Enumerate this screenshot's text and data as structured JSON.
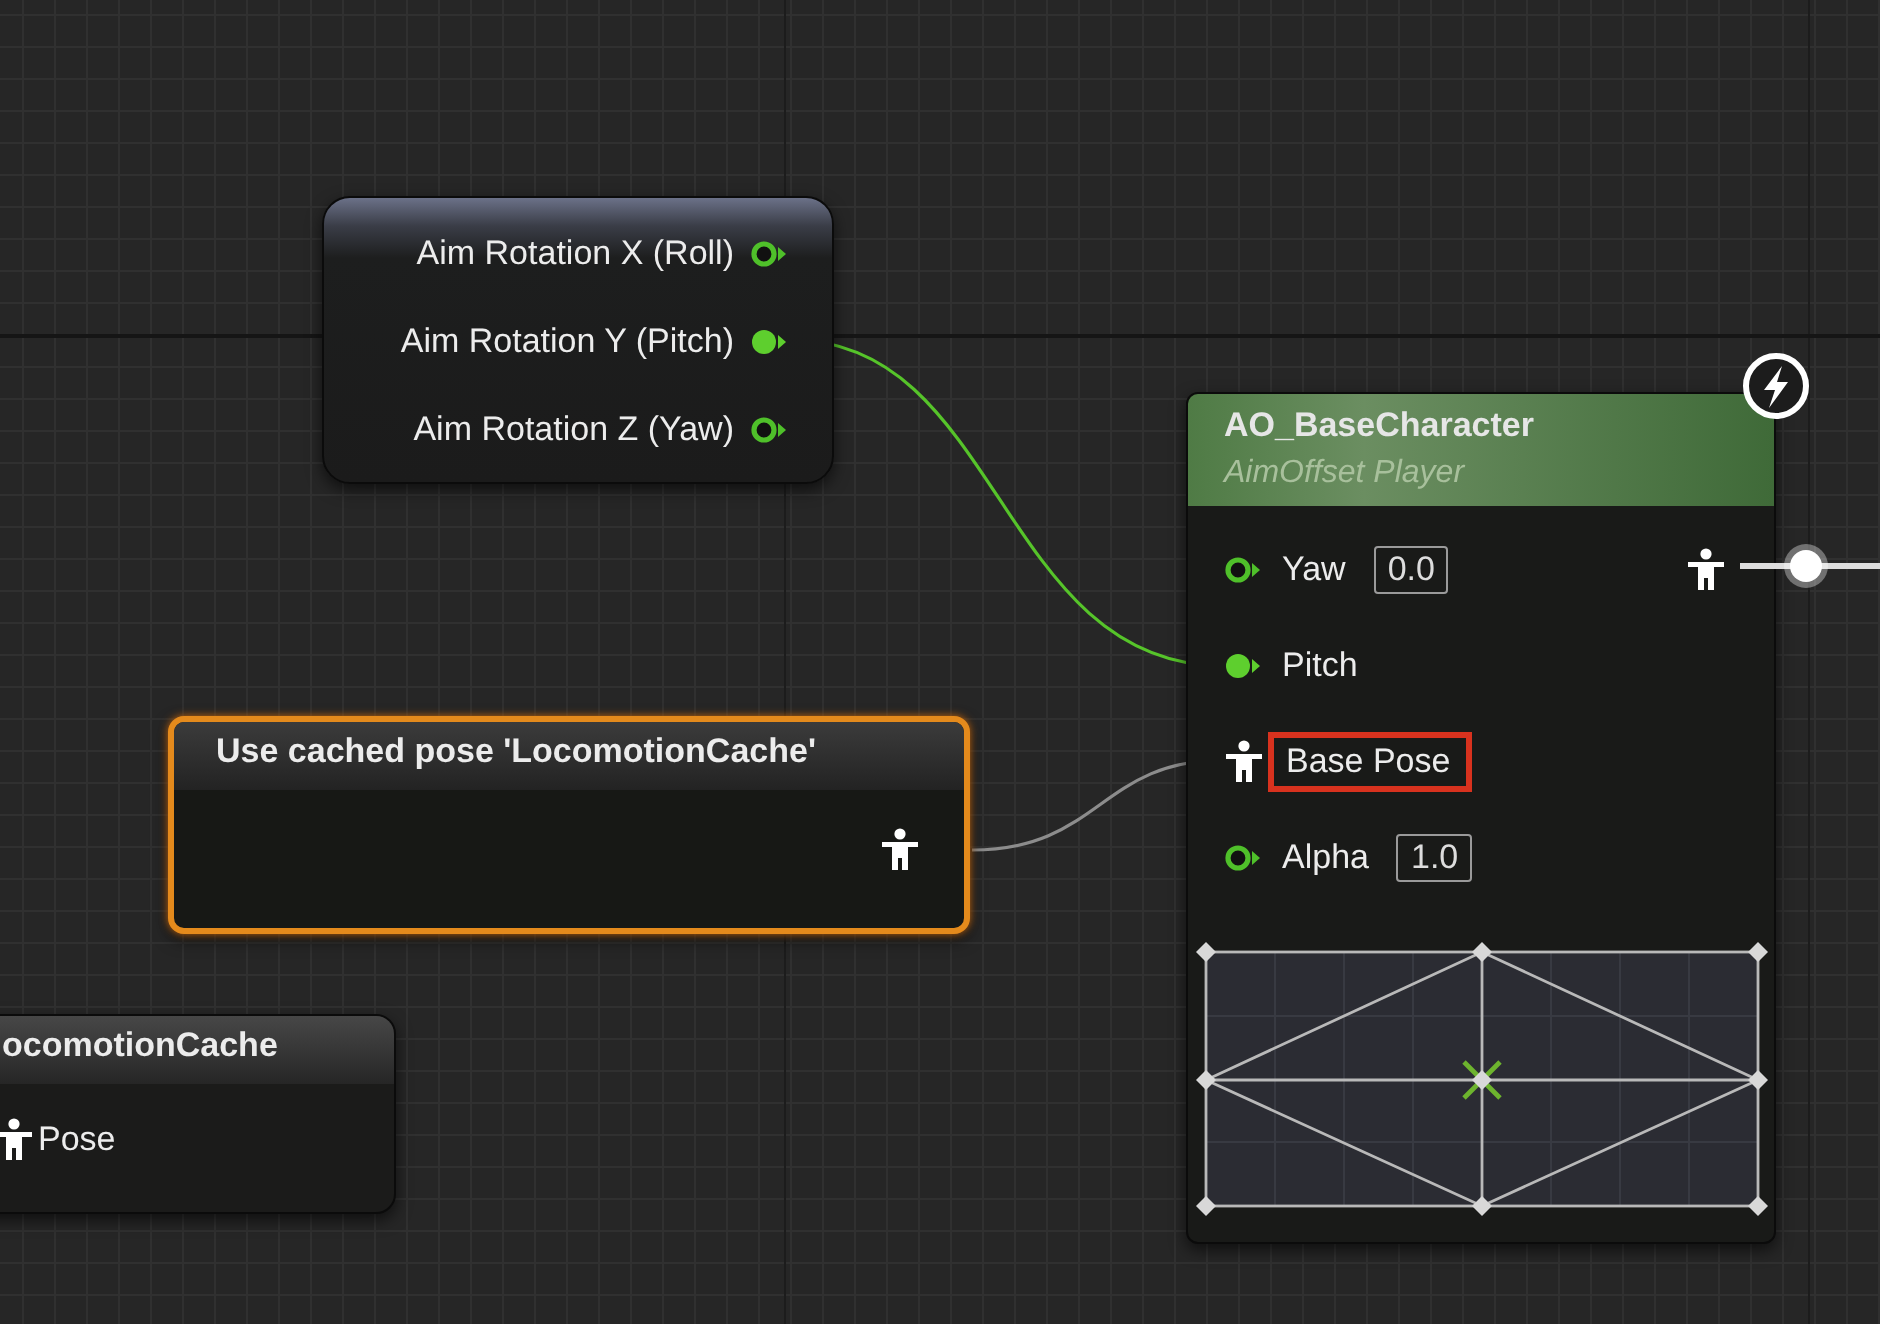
{
  "graph": {
    "nodes": [
      {
        "kind": "getter",
        "pins": [
          {
            "label": "Aim Rotation X (Roll)",
            "connected": false
          },
          {
            "label": "Aim Rotation Y (Pitch)",
            "connected": true
          },
          {
            "label": "Aim Rotation Z (Yaw)",
            "connected": false
          }
        ]
      },
      {
        "kind": "aim_offset",
        "title": "AO_BaseCharacter",
        "subtitle": "AimOffset Player",
        "inputs": [
          {
            "kind": "float",
            "label": "Yaw",
            "connected": false,
            "value": "0.0"
          },
          {
            "kind": "float",
            "label": "Pitch",
            "connected": true
          },
          {
            "kind": "pose",
            "label": "Base Pose",
            "highlighted": true
          },
          {
            "kind": "float",
            "label": "Alpha",
            "connected": false,
            "value": "1.0"
          }
        ]
      },
      {
        "kind": "cached_pose",
        "title": "Use cached pose 'LocomotionCache'",
        "selected": true
      },
      {
        "kind": "save_cache",
        "title": "ocomotionCache",
        "selected": false,
        "pins": [
          {
            "kind": "pose",
            "label": "Pose"
          }
        ]
      }
    ]
  }
}
